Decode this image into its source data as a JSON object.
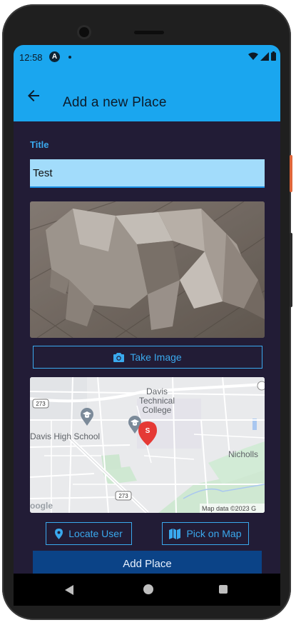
{
  "status": {
    "time": "12:58",
    "notif_icon": "A"
  },
  "appbar": {
    "title": "Add a new Place"
  },
  "form": {
    "title_label": "Title",
    "title_value": "Test",
    "take_image_label": "Take Image",
    "locate_user_label": "Locate User",
    "pick_on_map_label": "Pick on Map",
    "add_place_label": "Add Place"
  },
  "map": {
    "places": [
      "Davis",
      "Technical",
      "College",
      "Davis High School",
      "Nicholls"
    ],
    "road_labels": [
      "273",
      "273"
    ],
    "marker_letter": "S",
    "google_logo": "oogle",
    "attribution": "Map data ©2023 G"
  },
  "colors": {
    "accent": "#3aa9ee",
    "appbar": "#1aa6ef",
    "primary_button": "#0b4387",
    "background": "#221c36"
  },
  "icons": [
    "arrow-back-icon",
    "camera-icon",
    "location-pin-icon",
    "map-icon",
    "wifi-icon",
    "signal-icon",
    "battery-icon"
  ]
}
